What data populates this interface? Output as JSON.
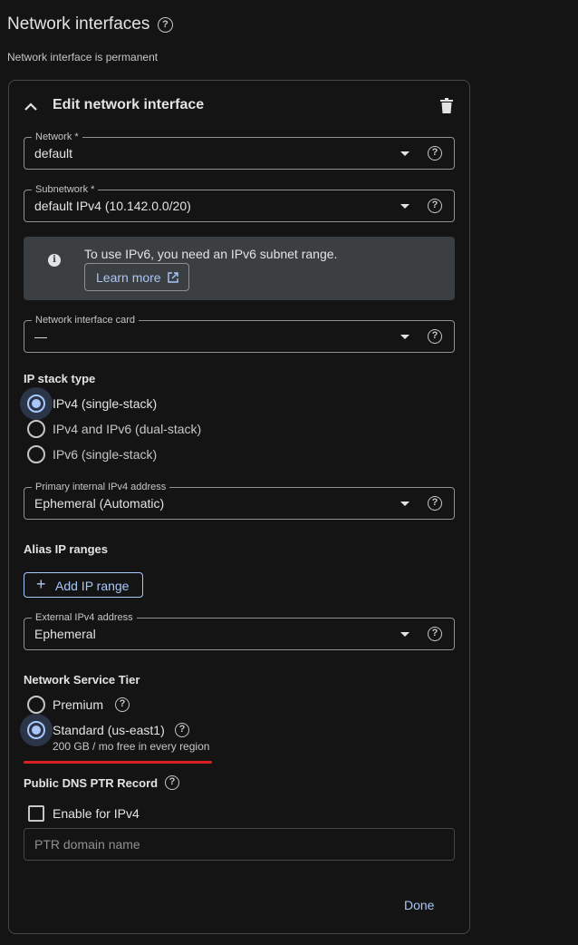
{
  "header": {
    "title": "Network interfaces",
    "subtitle": "Network interface is permanent"
  },
  "card": {
    "title": "Edit network interface",
    "network": {
      "label": "Network *",
      "value": "default"
    },
    "subnetwork": {
      "label": "Subnetwork *",
      "value": "default IPv4 (10.142.0.0/20)"
    },
    "info": {
      "text": "To use IPv6, you need an IPv6 subnet range.",
      "learn_more": "Learn more"
    },
    "nic": {
      "label": "Network interface card",
      "value": "—"
    },
    "ip_stack": {
      "title": "IP stack type",
      "options": [
        "IPv4 (single-stack)",
        "IPv4 and IPv6 (dual-stack)",
        "IPv6 (single-stack)"
      ],
      "selected": "IPv4 (single-stack)"
    },
    "primary_ip": {
      "label": "Primary internal IPv4 address",
      "value": "Ephemeral (Automatic)"
    },
    "alias": {
      "title": "Alias IP ranges",
      "add_label": "Add IP range"
    },
    "external_ip": {
      "label": "External IPv4 address",
      "value": "Ephemeral"
    },
    "tier": {
      "title": "Network Service Tier",
      "premium": "Premium",
      "standard": "Standard (us-east1)",
      "standard_note": "200 GB / mo free in every region",
      "selected": "Standard (us-east1)"
    },
    "dns": {
      "title": "Public DNS PTR Record",
      "checkbox_label": "Enable for IPv4",
      "placeholder": "PTR domain name"
    },
    "done_label": "Done"
  },
  "colors": {
    "accent": "#a8c7fa",
    "highlight": "#d92020",
    "background": "#141414"
  }
}
